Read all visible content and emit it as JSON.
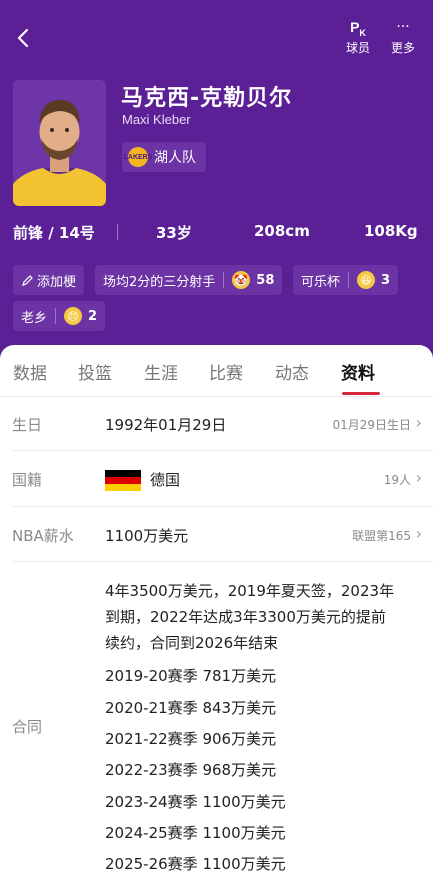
{
  "header": {
    "back_icon": "back-chevron-icon",
    "pk_label_main": "P",
    "pk_label_sub": "K",
    "pk_caption": "球员",
    "more_glyph": "···",
    "more_caption": "更多"
  },
  "player": {
    "name_cn": "马克西-克勒贝尔",
    "name_en": "Maxi Kleber",
    "team": "湖人队",
    "team_logo_text": "LAKERS"
  },
  "stats": {
    "position": "前锋 / 14号",
    "age": "33岁",
    "height": "208cm",
    "weight": "108Kg"
  },
  "tags": {
    "add": "添加梗",
    "tag1_label": "场均2分的三分射手",
    "tag1_count": "58",
    "tag2_label": "可乐杯",
    "tag2_count": "3",
    "tag3_label": "老乡",
    "tag3_count": "2"
  },
  "tabs": [
    "数据",
    "投篮",
    "生涯",
    "比赛",
    "动态",
    "资料"
  ],
  "active_tab": "资料",
  "profile": {
    "birthday_label": "生日",
    "birthday_value": "1992年01月29日",
    "birthday_right": "01月29日生日",
    "nationality_label": "国籍",
    "nationality_value": "德国",
    "nationality_right": "19人",
    "salary_label": "NBA薪水",
    "salary_value": "1100万美元",
    "salary_right": "联盟第165",
    "contract_label": "合同",
    "contract_summary": [
      "4年3500万美元，2019年夏天签，2023年",
      "到期，2022年达成3年3300万美元的提前",
      "续约，合同到2026年结束"
    ],
    "seasons": [
      "2019-20赛季 781万美元",
      "2020-21赛季 843万美元",
      "2021-22赛季 906万美元",
      "2022-23赛季 968万美元",
      "2023-24赛季 1100万美元",
      "2024-25赛季 1100万美元",
      "2025-26赛季 1100万美元"
    ]
  },
  "colors": {
    "hero_bg": "#5b1f96",
    "accent": "#d9283a",
    "flag_black": "#000000",
    "flag_red": "#dd0000",
    "flag_gold": "#ffce00"
  }
}
